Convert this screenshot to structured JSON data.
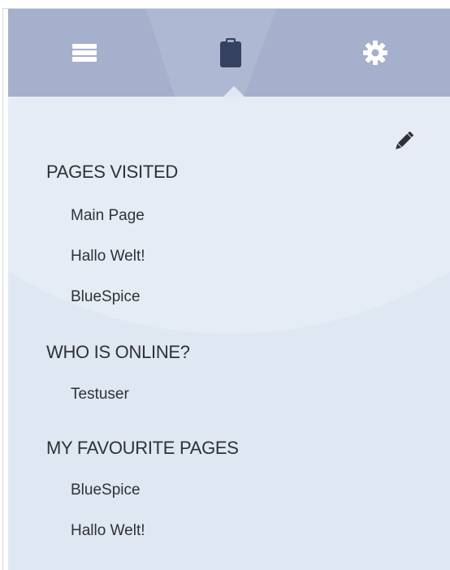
{
  "tabs": [
    {
      "icon": "hamburger-menu-icon",
      "active": false
    },
    {
      "icon": "clipboard-icon",
      "active": true
    },
    {
      "icon": "gear-icon",
      "active": false
    }
  ],
  "colors": {
    "tabbar_bg": "#a5b0cc",
    "panel_bg": "#dfe7f2",
    "icon_white": "#ffffff",
    "icon_active": "#34415f",
    "text": "#2f3136"
  },
  "edit_icon": "pencil-icon",
  "sections": {
    "pages_visited": {
      "title": "PAGES VISITED",
      "items": [
        "Main Page",
        "Hallo Welt!",
        "BlueSpice"
      ]
    },
    "who_is_online": {
      "title": "WHO IS ONLINE?",
      "items": [
        "Testuser"
      ]
    },
    "favourite_pages": {
      "title": "MY FAVOURITE PAGES",
      "items": [
        "BlueSpice",
        "Hallo Welt!"
      ]
    }
  }
}
